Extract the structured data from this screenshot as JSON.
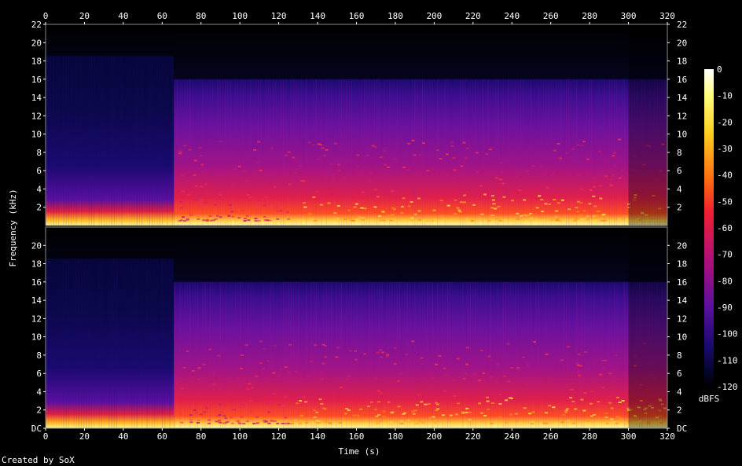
{
  "chart_data": {
    "type": "heatmap",
    "title": "",
    "xlabel": "Time (s)",
    "ylabel": "Frequency (kHz)",
    "xlim": [
      0,
      320
    ],
    "ylim": [
      0,
      22
    ],
    "x_ticks": [
      "0",
      "20",
      "40",
      "60",
      "80",
      "100",
      "120",
      "140",
      "160",
      "180",
      "200",
      "220",
      "240",
      "260",
      "280",
      "300",
      "320"
    ],
    "channels": [
      {
        "name": "upper channel",
        "y_ticks": [
          "22",
          "20",
          "18",
          "16",
          "14",
          "12",
          "10",
          "8",
          "6",
          "4",
          "2"
        ]
      },
      {
        "name": "lower channel",
        "y_ticks": [
          "20",
          "18",
          "16",
          "14",
          "12",
          "10",
          "8",
          "6",
          "4",
          "2",
          "DC"
        ]
      }
    ],
    "colorbar": {
      "label": "dBFS",
      "range": [
        -120,
        0
      ],
      "ticks": [
        "0",
        "-10",
        "-20",
        "-30",
        "-40",
        "-50",
        "-60",
        "-70",
        "-80",
        "-90",
        "-100",
        "-110",
        "-120"
      ]
    },
    "segments": [
      {
        "start_s": 0,
        "end_s": 66,
        "cutoff_khz": 18.5,
        "intensity": "low"
      },
      {
        "start_s": 66,
        "end_s": 320,
        "cutoff_khz": 16,
        "intensity": "high"
      }
    ]
  },
  "credit": "Created by SoX"
}
